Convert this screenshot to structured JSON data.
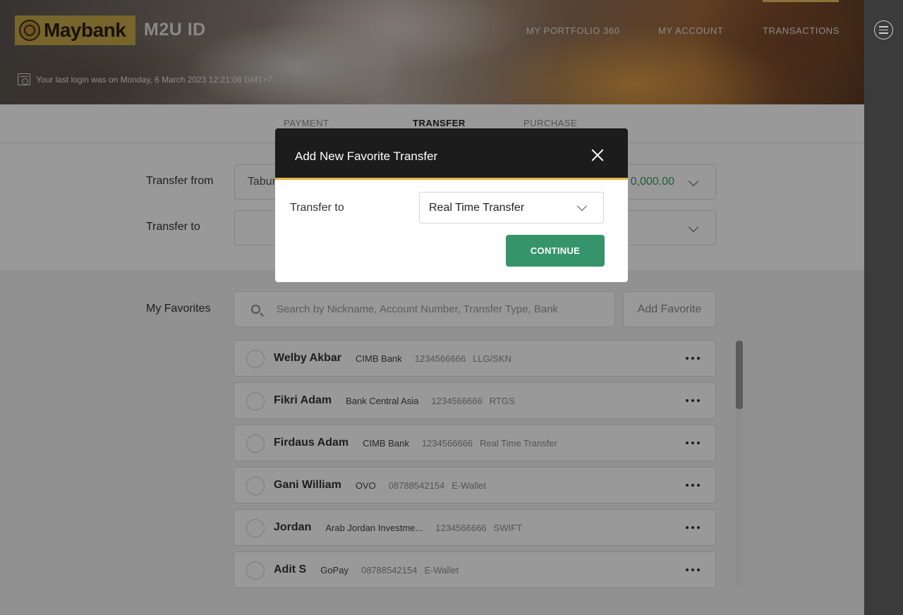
{
  "header": {
    "logo_text": "Maybank",
    "app_id": "M2U ID",
    "nav": [
      "MY PORTFOLIO 360",
      "MY ACCOUNT",
      "TRANSACTIONS"
    ],
    "last_login": "Your last login was on Monday, 6 March 2023 12:21:08 GMT+7"
  },
  "tabs": [
    "PAYMENT",
    "TRANSFER",
    "PURCHASE"
  ],
  "active_tab": "TRANSFER",
  "form": {
    "from_label": "Transfer from",
    "from_value": "Tabun",
    "from_amount": "0,000.00",
    "to_label": "Transfer to"
  },
  "favorites": {
    "label": "My Favorites",
    "search_placeholder": "Search by Nickname, Account Number, Transfer Type, Bank",
    "add_label": "Add Favorite",
    "items": [
      {
        "name": "Welby Akbar",
        "bank": "CIMB Bank",
        "account": "1234566666",
        "type": "LLG/SKN"
      },
      {
        "name": "Fikri Adam",
        "bank": "Bank Central Asia",
        "account": "1234566666",
        "type": "RTGS"
      },
      {
        "name": "Firdaus Adam",
        "bank": "CIMB Bank",
        "account": "1234566666",
        "type": "Real Time Transfer"
      },
      {
        "name": "Gani William",
        "bank": "OVO",
        "account": "08788542154",
        "type": "E-Wallet"
      },
      {
        "name": "Jordan",
        "bank": "Arab Jordan Investme...",
        "account": "1234566666",
        "type": "SWIFT"
      },
      {
        "name": "Adit S",
        "bank": "GoPay",
        "account": "08788542154",
        "type": "E-Wallet"
      }
    ]
  },
  "modal": {
    "title": "Add New Favorite Transfer",
    "field_label": "Transfer to",
    "select_value": "Real Time Transfer",
    "continue_label": "CONTINUE"
  },
  "colors": {
    "brand_gold": "#c9a84a",
    "accent_green": "#35946a",
    "modal_header": "#1c1c1c",
    "modal_underline": "#e8b540"
  }
}
